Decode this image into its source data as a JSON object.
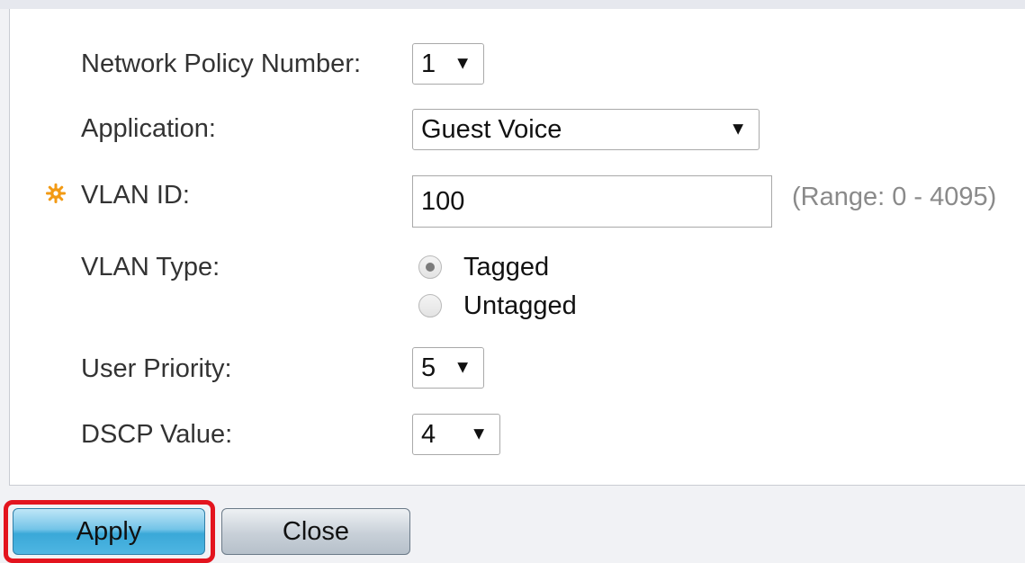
{
  "form": {
    "policy_number": {
      "label": "Network Policy Number:",
      "value": "1"
    },
    "application": {
      "label": "Application:",
      "value": "Guest Voice"
    },
    "vlan_id": {
      "label": "VLAN ID:",
      "value": "100",
      "range_hint": "(Range: 0 - 4095)"
    },
    "vlan_type": {
      "label": "VLAN Type:",
      "options": [
        "Tagged",
        "Untagged"
      ],
      "selected": "Tagged"
    },
    "user_priority": {
      "label": "User Priority:",
      "value": "5"
    },
    "dscp_value": {
      "label": "DSCP Value:",
      "value": "4"
    }
  },
  "buttons": {
    "apply_label": "Apply",
    "close_label": "Close"
  },
  "colors": {
    "required_icon": "#f29a14",
    "highlight": "#e3141e",
    "apply_button": "#4fb6e2"
  },
  "icons": {
    "dropdown": "chevron-down-icon",
    "required": "required-asterisk-icon"
  }
}
